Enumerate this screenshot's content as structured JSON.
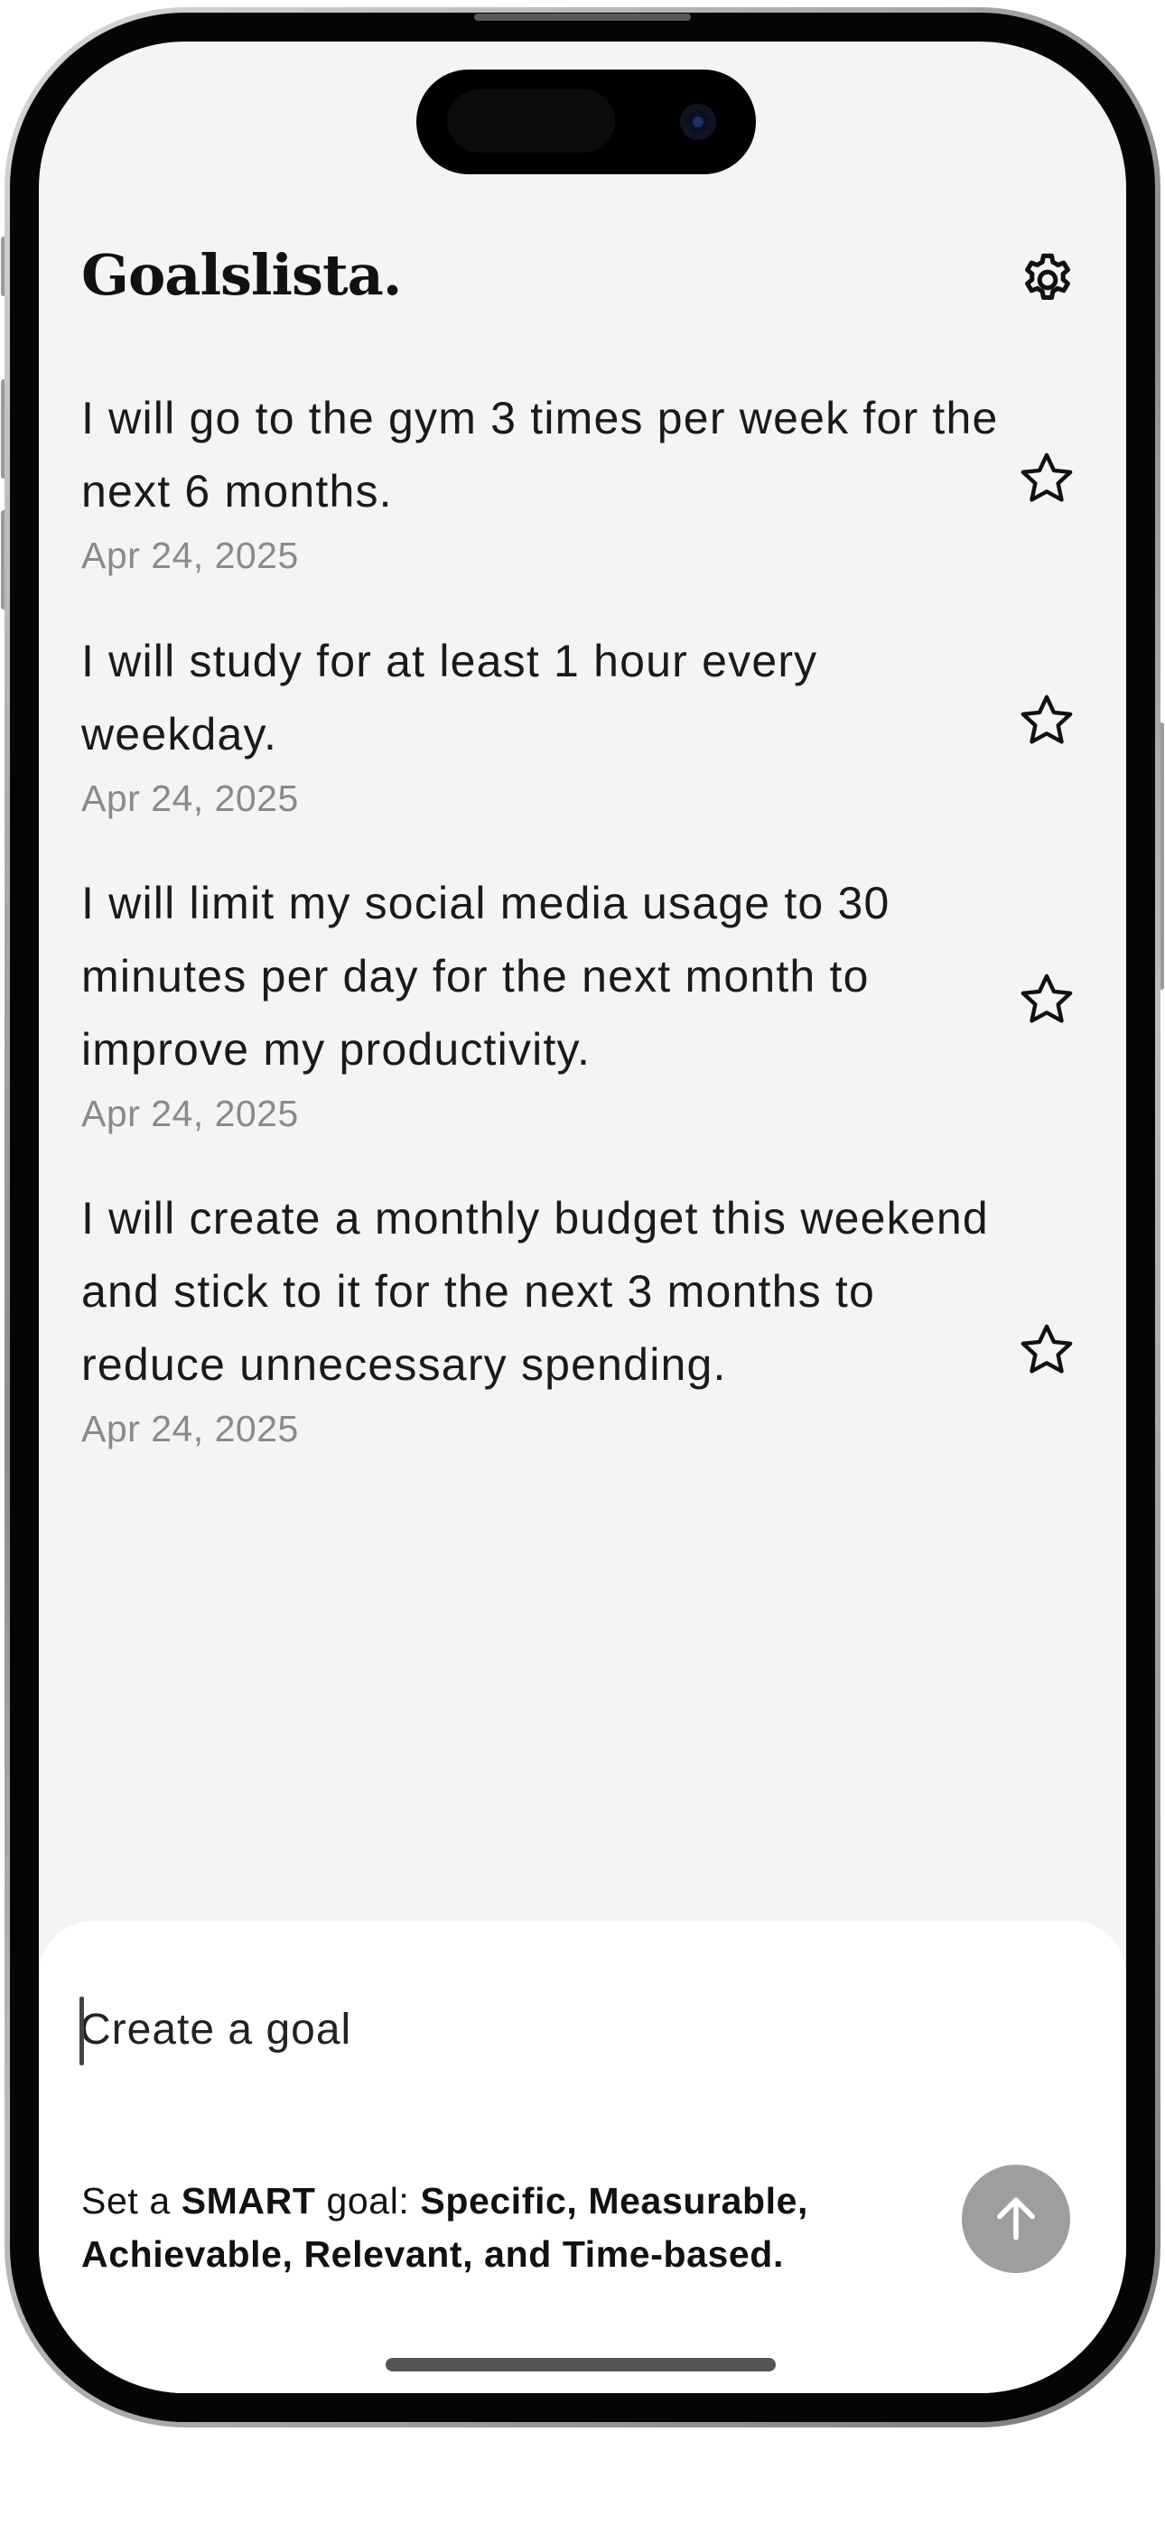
{
  "app": {
    "title": "Goalslista."
  },
  "goals": [
    {
      "text": "I will go to the gym 3 times per week for the next 6 months.",
      "date": "Apr 24, 2025"
    },
    {
      "text": "I will study for at least 1 hour every weekday.",
      "date": "Apr 24, 2025"
    },
    {
      "text": "I will limit my social media usage to 30 minutes per day for the next month to improve my productivity.",
      "date": "Apr 24, 2025"
    },
    {
      "text": "I will create a monthly budget this weekend and stick to it for the next 3 months to reduce unnecessary spending.",
      "date": "Apr 24, 2025"
    }
  ],
  "composer": {
    "placeholder": "Create a goal",
    "hint_prefix": "Set a ",
    "hint_smart": "SMART",
    "hint_middle": " goal: ",
    "hint_criteria": "Specific, Measurable, Achievable, Relevant, and Time-based."
  },
  "icons": {
    "settings": "gear-icon",
    "favorite": "star-outline-icon",
    "send": "arrow-up-icon"
  },
  "colors": {
    "background": "#f4f4f4",
    "sheet": "#ffffff",
    "send_button": "#9e9e9e",
    "date_text": "#8a8a8a"
  }
}
